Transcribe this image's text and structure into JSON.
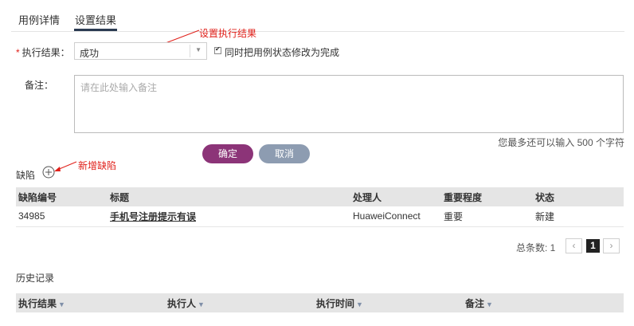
{
  "tabs": [
    {
      "label": "用例详情"
    },
    {
      "label": "设置结果",
      "active": true
    }
  ],
  "annotations": {
    "set_result": "设置执行结果",
    "add_defect": "新增缺陷"
  },
  "form": {
    "result_label": "执行结果：",
    "required_mark": "*",
    "result_value": "成功",
    "sync_checkbox_label": "同时把用例状态修改为完成",
    "sync_checked": true,
    "remark_label": "备注：",
    "remark_placeholder": "请在此处输入备注",
    "char_counter": "您最多还可以输入 500 个字符",
    "ok_label": "确定",
    "cancel_label": "取消"
  },
  "defects": {
    "title": "缺陷",
    "columns": [
      "缺陷编号",
      "标题",
      "处理人",
      "重要程度",
      "状态"
    ],
    "rows": [
      {
        "id": "34985",
        "title": "手机号注册提示有误",
        "owner": "HuaweiConnect",
        "severity": "重要",
        "status": "新建"
      }
    ],
    "pager": {
      "total_text": "总条数: 1",
      "current_page": "1",
      "prev": "‹",
      "next": "›"
    }
  },
  "history": {
    "title": "历史记录",
    "columns": [
      "执行结果",
      "执行人",
      "执行时间",
      "备注"
    ]
  },
  "colors": {
    "primary_button": "#8c3478",
    "cancel_button": "#8d9cb1",
    "annotation": "#e0201a",
    "tab_underline": "#2b3b52"
  }
}
